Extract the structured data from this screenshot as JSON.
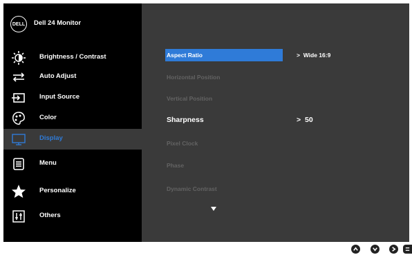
{
  "header": {
    "logo_text": "DELL",
    "title": "Dell 24 Monitor"
  },
  "menu": [
    {
      "label": "Brightness / Contrast",
      "icon": "brightness-icon",
      "active": false
    },
    {
      "label": "Auto Adjust",
      "icon": "auto-adjust-icon",
      "active": false
    },
    {
      "label": "Input Source",
      "icon": "input-source-icon",
      "active": false
    },
    {
      "label": "Color",
      "icon": "color-palette-icon",
      "active": false
    },
    {
      "label": "Display",
      "icon": "display-monitor-icon",
      "active": true
    },
    {
      "label": "Menu",
      "icon": "menu-icon",
      "active": false
    },
    {
      "label": "Personalize",
      "icon": "star-icon",
      "active": false
    },
    {
      "label": "Others",
      "icon": "others-sliders-icon",
      "active": false
    }
  ],
  "display_settings": [
    {
      "label": "Aspect Ratio",
      "value": "Wide 16:9",
      "state": "selected"
    },
    {
      "label": "Horizontal Position",
      "value": "",
      "state": "disabled"
    },
    {
      "label": "Vertical Position",
      "value": "",
      "state": "disabled"
    },
    {
      "label": "Sharpness",
      "value": "50",
      "state": "emphasized"
    },
    {
      "label": "Pixel Clock",
      "value": "",
      "state": "disabled"
    },
    {
      "label": "Phase",
      "value": "",
      "state": "disabled"
    },
    {
      "label": "Dynamic Contrast",
      "value": "",
      "state": "disabled"
    }
  ],
  "value_prefix": ">",
  "buttons": [
    {
      "icon": "up-button-icon"
    },
    {
      "icon": "down-button-icon"
    },
    {
      "icon": "right-button-icon"
    },
    {
      "icon": "exit-button-icon"
    }
  ],
  "colors": {
    "accent": "#2f7bd8",
    "panel_dark": "#000000",
    "panel_gray": "#3a3a3a",
    "disabled_text": "#636363"
  }
}
